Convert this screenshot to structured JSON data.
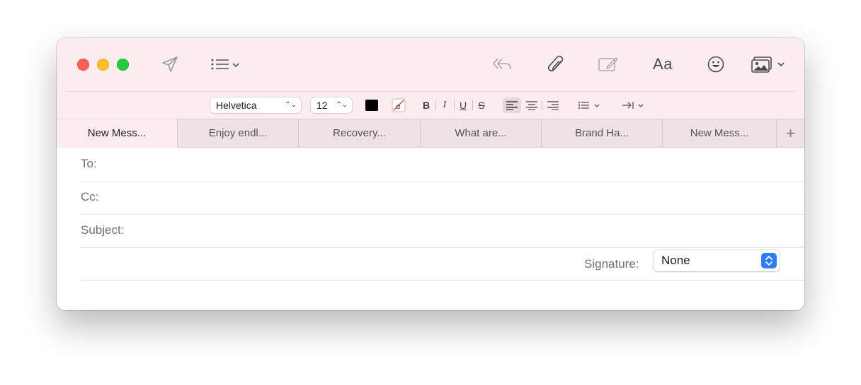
{
  "toolbar": {
    "icons": [
      "send-icon",
      "list-icon",
      "reply-icon",
      "attachment-icon",
      "markup-icon",
      "emoji-icon",
      "photo-icon"
    ],
    "font_button_label": "Aa"
  },
  "format_bar": {
    "font_family": "Helvetica",
    "font_size": "12",
    "color_swatch": "#000000",
    "bold_label": "B",
    "italic_label": "I",
    "underline_label": "U",
    "strike_label": "S"
  },
  "tabs": [
    {
      "label": "New Mess..."
    },
    {
      "label": "Enjoy endl..."
    },
    {
      "label": "Recovery..."
    },
    {
      "label": "What are..."
    },
    {
      "label": "Brand Ha..."
    },
    {
      "label": "New Mess..."
    }
  ],
  "new_tab_label": "+",
  "compose": {
    "to": {
      "label": "To:",
      "value": ""
    },
    "cc": {
      "label": "Cc:",
      "value": ""
    },
    "subject": {
      "label": "Subject:",
      "value": ""
    },
    "signature_label": "Signature:",
    "signature_value": "None"
  },
  "colors": {
    "chrome_bg": "#fbeded",
    "accent": "#2f7cf6",
    "close": "#fe5f57",
    "minimize": "#febc2e",
    "zoom": "#28c840"
  }
}
